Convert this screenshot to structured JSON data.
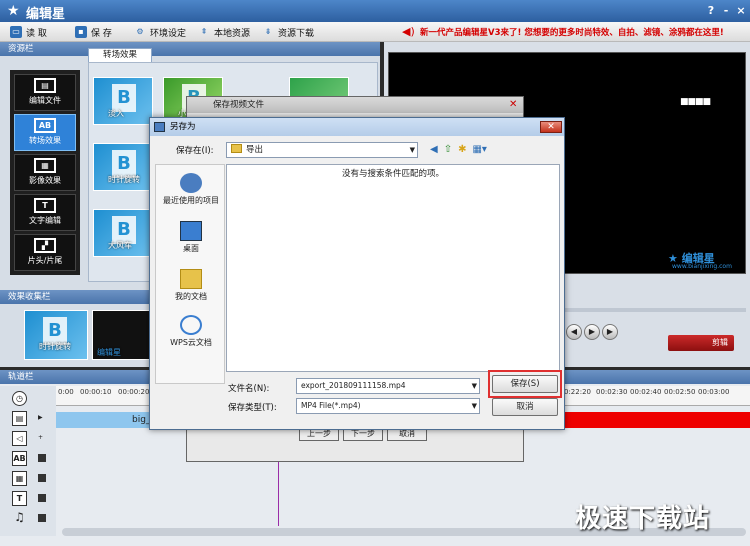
{
  "app": {
    "title": "编辑星",
    "banner": "新一代产品编辑星V3来了! 您想要的更多时尚特效、自拍、滤镜、涂鸦都在这里!",
    "win_help": "?",
    "win_min": "-",
    "win_close": "×"
  },
  "toolbar": {
    "read": "读  取",
    "save": "保  存",
    "env": "环境设定",
    "local": "本地资源",
    "download": "资源下载"
  },
  "left": {
    "resource_label": "资源栏",
    "tab_transition": "转场效果",
    "collection_label": "效果收集栏",
    "nav": [
      "编辑文件",
      "转场效果",
      "影像效果",
      "文字编辑",
      "片头/片尾"
    ],
    "nav_icons": [
      "film-icon",
      "ab-icon",
      "effect-icon",
      "text-icon",
      "blocks-icon"
    ],
    "thumbs": [
      "淡入",
      "小球",
      "时针旋转",
      "大风车"
    ],
    "collect": [
      "时针旋转",
      "编辑星"
    ]
  },
  "preview": {
    "logo": "★ 编辑星",
    "logo_url": "www.bianjixing.com",
    "cut_label": "剪辑"
  },
  "timeline": {
    "label": "轨道栏",
    "clip_name": "big_",
    "ticks_left": [
      "0:00",
      "00:00:10",
      "00:00:20"
    ],
    "ticks_right": [
      "0:22:20",
      "00:02:30",
      "00:02:40",
      "00:02:50",
      "00:03:00"
    ]
  },
  "bg_dialog": {
    "title": "保存视频文件",
    "prev": "上一步",
    "next": "下一步",
    "cancel": "取消"
  },
  "dialog": {
    "title": "另存为",
    "save_in_label": "保存在(I):",
    "save_in_value": "导出",
    "places": [
      "最近使用的项目",
      "桌面",
      "我的文档",
      "WPS云文档"
    ],
    "empty_msg": "没有与搜索条件匹配的项。",
    "filename_label": "文件名(N):",
    "filename_value": "export_201809111158.mp4",
    "filetype_label": "保存类型(T):",
    "filetype_value": "MP4 File(*.mp4)",
    "save_btn": "保存(S)",
    "cancel_btn": "取消"
  },
  "watermark": "极速下载站"
}
